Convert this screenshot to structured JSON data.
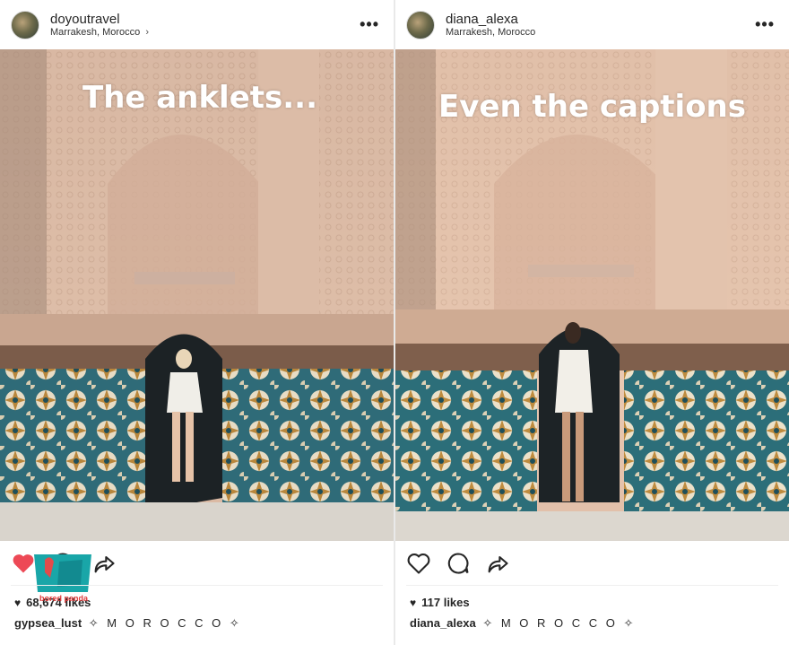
{
  "posts": [
    {
      "username": "doyoutravel",
      "location": "Marrakesh, Morocco",
      "location_chevron": "›",
      "more": "•••",
      "overlay_text": "The anklets...",
      "likes": "68,674 likes",
      "caption_user": "gypsea_lust",
      "caption_text": "✧ M O R O C C O ✧",
      "liked": true
    },
    {
      "username": "diana_alexa",
      "location": "Marrakesh, Morocco",
      "more": "•••",
      "overlay_text": "Even the captions",
      "likes": "117 likes",
      "caption_user": "diana_alexa",
      "caption_text": "✧ M O R O C C O ✧",
      "liked": false
    }
  ],
  "watermark": {
    "text": "bored panda"
  },
  "icons": {
    "like": "heart-icon",
    "comment": "comment-icon",
    "share": "share-arrow-icon",
    "more": "more-options-icon"
  },
  "colors": {
    "like_red": "#ed4956",
    "text": "#262626",
    "muted": "#8e8e8e"
  }
}
